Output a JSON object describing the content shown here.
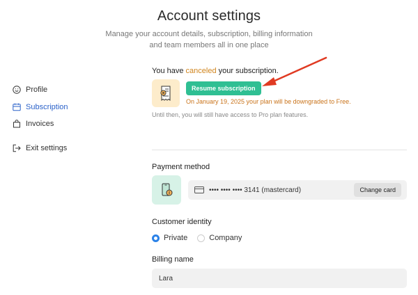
{
  "header": {
    "title": "Account settings",
    "subtitle_line1": "Manage your account details, subscription, billing information",
    "subtitle_line2": "and team members all in one place"
  },
  "sidebar": {
    "items": [
      {
        "label": "Profile",
        "icon": "smile-icon"
      },
      {
        "label": "Subscription",
        "icon": "card-calendar-icon",
        "active": true
      },
      {
        "label": "Invoices",
        "icon": "shopping-bag-icon"
      },
      {
        "label": "Exit settings",
        "icon": "exit-icon"
      }
    ]
  },
  "subscription": {
    "status_prefix": "You have ",
    "status_highlight": "canceled",
    "status_suffix": " your subscription.",
    "resume_label": "Resume subscription",
    "downgrade_text": "On January 19, 2025 your plan will be downgraded to Free.",
    "until_text": "Until then, you will still have access to Pro plan features.",
    "icon": "receipt-icon"
  },
  "payment": {
    "label": "Payment method",
    "card_text": "•••• •••• •••• 3141  (mastercard)",
    "change_label": "Change card",
    "icon": "phone-coin-icon"
  },
  "identity": {
    "label": "Customer identity",
    "options": [
      {
        "label": "Private",
        "checked": true
      },
      {
        "label": "Company",
        "checked": false
      }
    ]
  },
  "billing": {
    "label": "Billing name",
    "value": "Lara"
  },
  "colors": {
    "accent_green": "#2fbf93",
    "highlight_orange": "#d0841c",
    "active_blue": "#2b62c9",
    "arrow_red": "#e03a22"
  }
}
